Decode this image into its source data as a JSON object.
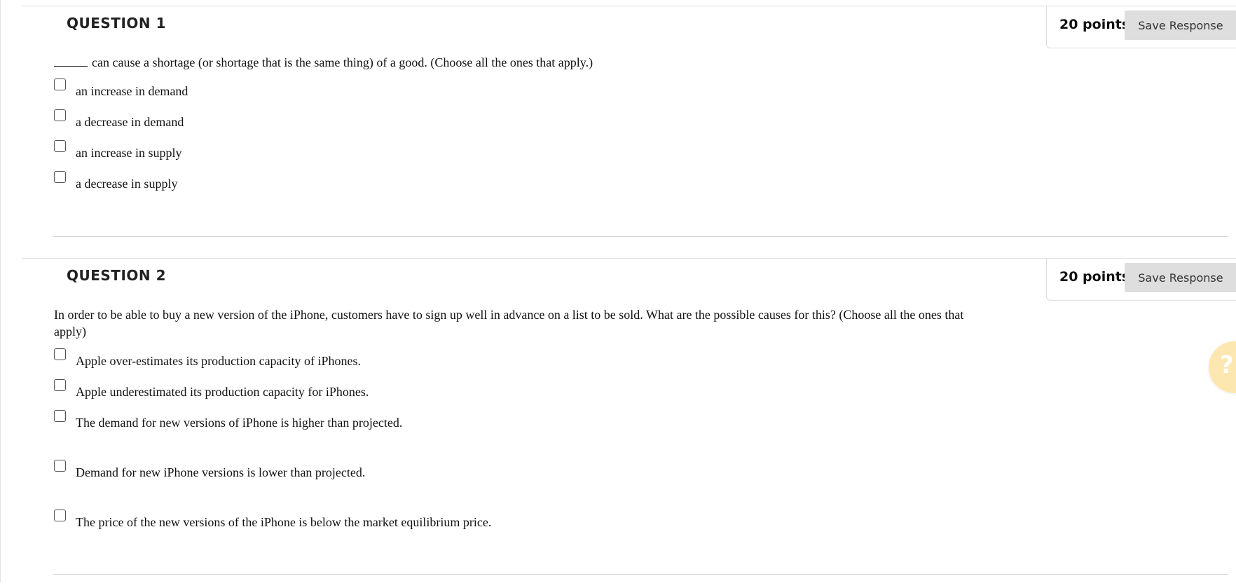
{
  "questions": [
    {
      "title": "QUESTION 1",
      "points": "20 points",
      "save_label": "Save Response",
      "prompt": "can cause a shortage (or shortage that is the same thing) of a good. (Choose all the ones that apply.)",
      "has_blank": true,
      "options": [
        "an increase in demand",
        "a decrease in demand",
        "an increase in supply",
        "a decrease in supply"
      ]
    },
    {
      "title": "QUESTION 2",
      "points": "20 points",
      "save_label": "Save Response",
      "prompt": "In order to be able to buy a new version of the iPhone, customers have to sign up well in advance on a list to be sold. What are the possible causes for this? (Choose all the ones that apply)",
      "has_blank": false,
      "options": [
        "Apple over-estimates its production capacity of iPhones.",
        "Apple underestimated its production capacity for iPhones.",
        "The demand for new versions of iPhone is higher than projected.",
        "Demand for new iPhone versions is lower than projected.",
        "The price of the new versions of the iPhone is below the market equilibrium price."
      ]
    }
  ],
  "help_button": {
    "icon": "question-mark-icon",
    "glyph": "?",
    "color": "#fde7b0"
  },
  "colors": {
    "save_button_bg": "#dedede",
    "divider": "#d6d6d6"
  }
}
